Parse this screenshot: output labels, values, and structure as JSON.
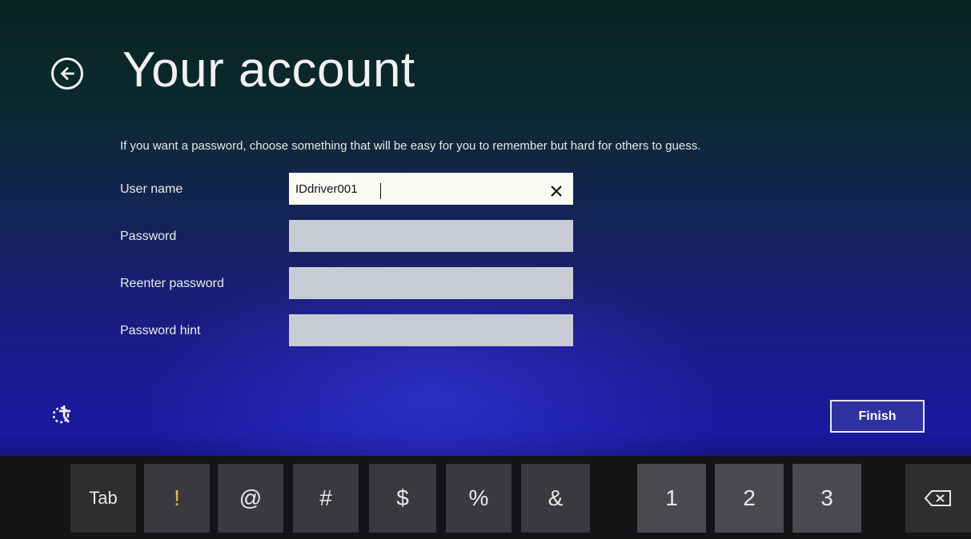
{
  "header": {
    "title": "Your account",
    "back_icon": "back-arrow-icon"
  },
  "form": {
    "instruction": "If you want a password, choose something that will be easy for you to remember but hard for others to guess.",
    "username_label": "User name",
    "username_value": "IDdriver001",
    "password_label": "Password",
    "password_value": "",
    "reenter_label": "Reenter password",
    "reenter_value": "",
    "hint_label": "Password hint",
    "hint_value": ""
  },
  "actions": {
    "finish_label": "Finish",
    "ease_of_access_icon": "ease-of-access-icon"
  },
  "keyboard": {
    "tab": "Tab",
    "symbols": [
      "!",
      "@",
      "#",
      "$",
      "%",
      "&"
    ],
    "numbers": [
      "1",
      "2",
      "3"
    ],
    "backspace_icon": "backspace-icon"
  },
  "colors": {
    "accent": "#2f31a0",
    "background_top": "#07231e",
    "background_bottom": "#1a1aa0"
  }
}
